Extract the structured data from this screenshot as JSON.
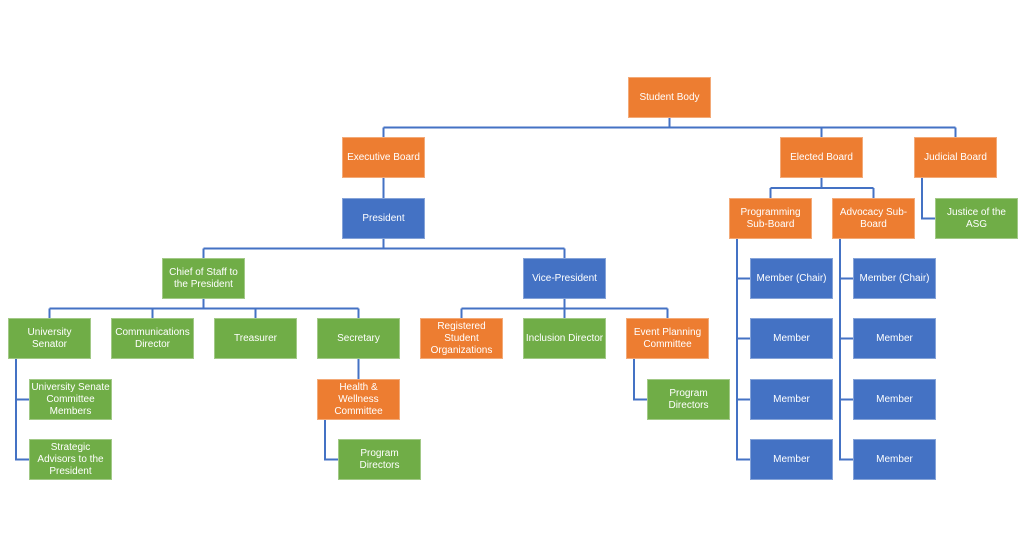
{
  "colors": {
    "orange": "#ed7d31",
    "blue": "#4472c4",
    "green": "#70ad47",
    "connector": "#4472c4"
  },
  "nodes": [
    {
      "id": "student-body",
      "label": "Student Body",
      "color": "orange"
    },
    {
      "id": "executive-board",
      "label": "Executive Board",
      "color": "orange"
    },
    {
      "id": "elected-board",
      "label": "Elected Board",
      "color": "orange"
    },
    {
      "id": "judicial-board",
      "label": "Judicial Board",
      "color": "orange"
    },
    {
      "id": "president",
      "label": "President",
      "color": "blue"
    },
    {
      "id": "programming-sub-board",
      "label": "Programming Sub-Board",
      "color": "orange"
    },
    {
      "id": "advocacy-sub-board",
      "label": "Advocacy Sub-Board",
      "color": "orange"
    },
    {
      "id": "justice-asg",
      "label": "Justice of the ASG",
      "color": "green"
    },
    {
      "id": "chief-of-staff",
      "label": "Chief of Staff to the President",
      "color": "green"
    },
    {
      "id": "vice-president",
      "label": "Vice-President",
      "color": "blue"
    },
    {
      "id": "university-senator",
      "label": "University Senator",
      "color": "green"
    },
    {
      "id": "communications-director",
      "label": "Communications Director",
      "color": "green"
    },
    {
      "id": "treasurer",
      "label": "Treasurer",
      "color": "green"
    },
    {
      "id": "secretary",
      "label": "Secretary",
      "color": "green"
    },
    {
      "id": "registered-student-orgs",
      "label": "Registered Student Organizations",
      "color": "orange"
    },
    {
      "id": "inclusion-director",
      "label": "Inclusion Director",
      "color": "green"
    },
    {
      "id": "event-planning-committee",
      "label": "Event Planning Committee",
      "color": "orange"
    },
    {
      "id": "senate-committee-members",
      "label": "University Senate Committee Members",
      "color": "green"
    },
    {
      "id": "strategic-advisors",
      "label": "Strategic Advisors to the President",
      "color": "green"
    },
    {
      "id": "health-wellness-committee",
      "label": "Health & Wellness Committee",
      "color": "orange"
    },
    {
      "id": "program-directors-hw",
      "label": "Program Directors",
      "color": "green"
    },
    {
      "id": "program-directors-ep",
      "label": "Program Directors",
      "color": "green"
    },
    {
      "id": "prog-member-chair",
      "label": "Member (Chair)",
      "color": "blue"
    },
    {
      "id": "prog-member-1",
      "label": "Member",
      "color": "blue"
    },
    {
      "id": "prog-member-2",
      "label": "Member",
      "color": "blue"
    },
    {
      "id": "prog-member-3",
      "label": "Member",
      "color": "blue"
    },
    {
      "id": "adv-member-chair",
      "label": "Member (Chair)",
      "color": "blue"
    },
    {
      "id": "adv-member-1",
      "label": "Member",
      "color": "blue"
    },
    {
      "id": "adv-member-2",
      "label": "Member",
      "color": "blue"
    },
    {
      "id": "adv-member-3",
      "label": "Member",
      "color": "blue"
    }
  ],
  "edges": [
    [
      "student-body",
      "executive-board"
    ],
    [
      "student-body",
      "elected-board"
    ],
    [
      "student-body",
      "judicial-board"
    ],
    [
      "executive-board",
      "president"
    ],
    [
      "elected-board",
      "programming-sub-board"
    ],
    [
      "elected-board",
      "advocacy-sub-board"
    ],
    [
      "judicial-board",
      "justice-asg"
    ],
    [
      "president",
      "chief-of-staff"
    ],
    [
      "president",
      "vice-president"
    ],
    [
      "chief-of-staff",
      "university-senator"
    ],
    [
      "chief-of-staff",
      "communications-director"
    ],
    [
      "chief-of-staff",
      "treasurer"
    ],
    [
      "chief-of-staff",
      "secretary"
    ],
    [
      "vice-president",
      "registered-student-orgs"
    ],
    [
      "vice-president",
      "inclusion-director"
    ],
    [
      "vice-president",
      "event-planning-committee"
    ],
    [
      "university-senator",
      "senate-committee-members"
    ],
    [
      "university-senator",
      "strategic-advisors"
    ],
    [
      "secretary",
      "health-wellness-committee"
    ],
    [
      "health-wellness-committee",
      "program-directors-hw"
    ],
    [
      "event-planning-committee",
      "program-directors-ep"
    ],
    [
      "programming-sub-board",
      "prog-member-chair"
    ],
    [
      "programming-sub-board",
      "prog-member-1"
    ],
    [
      "programming-sub-board",
      "prog-member-2"
    ],
    [
      "programming-sub-board",
      "prog-member-3"
    ],
    [
      "advocacy-sub-board",
      "adv-member-chair"
    ],
    [
      "advocacy-sub-board",
      "adv-member-1"
    ],
    [
      "advocacy-sub-board",
      "adv-member-2"
    ],
    [
      "advocacy-sub-board",
      "adv-member-3"
    ]
  ]
}
